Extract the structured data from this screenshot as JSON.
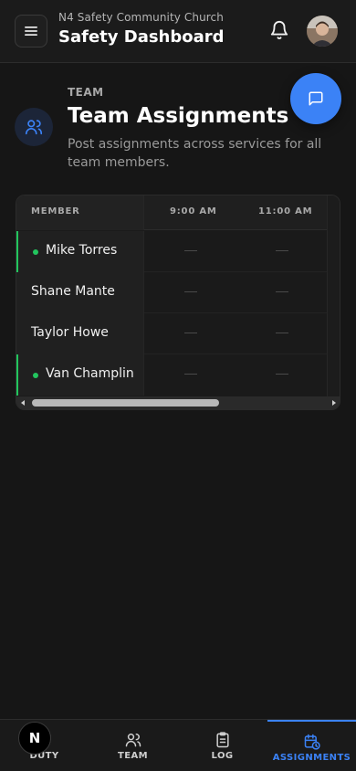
{
  "header": {
    "org_name": "N4 Safety Community Church",
    "title": "Safety Dashboard"
  },
  "section": {
    "eyebrow": "TEAM",
    "title": "Team Assignments",
    "description": "Post assignments across services for all team members."
  },
  "table": {
    "columns": [
      "MEMBER",
      "9:00 AM",
      "11:00 AM"
    ],
    "rows": [
      {
        "name": "Mike Torres",
        "active": true,
        "cells": [
          "—",
          "—"
        ]
      },
      {
        "name": "Shane Mante",
        "active": false,
        "cells": [
          "—",
          "—"
        ]
      },
      {
        "name": "Taylor Howe",
        "active": false,
        "cells": [
          "—",
          "—"
        ]
      },
      {
        "name": "Van Champlin",
        "active": true,
        "cells": [
          "—",
          "—"
        ]
      }
    ]
  },
  "nav": {
    "items": [
      {
        "label": "DUTY",
        "icon": "shield-icon"
      },
      {
        "label": "TEAM",
        "icon": "users-icon"
      },
      {
        "label": "LOG",
        "icon": "clipboard-icon"
      },
      {
        "label": "ASSIGNMENTS",
        "icon": "calendar-clock-icon",
        "active": true
      }
    ]
  },
  "badge": {
    "letter": "N"
  },
  "colors": {
    "accent": "#3b82f6",
    "active_green": "#22c55e",
    "background": "#161616"
  }
}
